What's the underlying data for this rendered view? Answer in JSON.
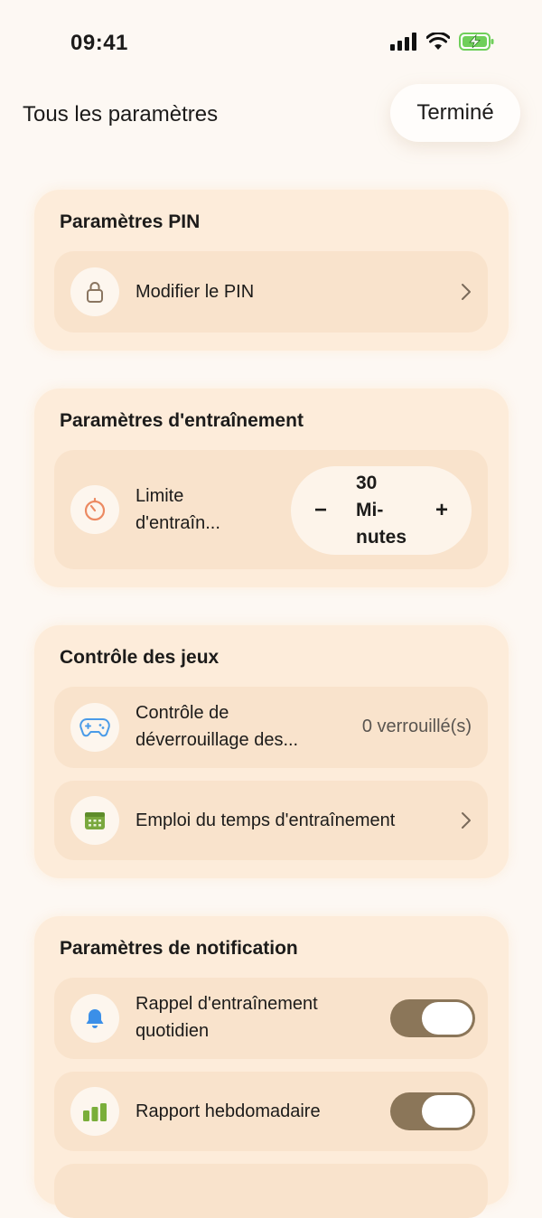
{
  "status_bar": {
    "time": "09:41"
  },
  "header": {
    "title": "Tous les paramètres",
    "done_label": "Terminé"
  },
  "sections": {
    "pin": {
      "title": "Paramètres PIN",
      "change_pin": "Modifier le PIN"
    },
    "training": {
      "title": "Paramètres d'entraînement",
      "limit_line1": "Limite",
      "limit_line2": "d'entraîn...",
      "stepper_minus": "−",
      "stepper_plus": "+",
      "stepper_value_line1": "30",
      "stepper_value_line2": "Mi-",
      "stepper_value_line3": "nutes"
    },
    "games": {
      "title": "Contrôle des jeux",
      "unlock_line1": "Contrôle de",
      "unlock_line2": "déverrouillage des...",
      "unlock_value": "0 verrouillé(s)",
      "schedule": "Emploi du temps d'entraînement"
    },
    "notifications": {
      "title": "Paramètres de notification",
      "daily_line1": "Rappel d'entraînement",
      "daily_line2": "quotidien",
      "daily_on": true,
      "weekly": "Rapport hebdomadaire",
      "weekly_on": true
    }
  },
  "colors": {
    "background": "#fdf8f3",
    "section": "#fdecda",
    "row": "#f9e3cc",
    "toggle_on": "#8b7659",
    "timer_icon": "#ec8a62",
    "gamepad_icon": "#4a9be8",
    "calendar_icon": "#7aa83e",
    "bell_icon": "#3b8fe8",
    "bars_icon": "#7aae3a"
  },
  "icons": [
    "signal-icon",
    "wifi-icon",
    "battery-charging-icon",
    "lock-icon",
    "chevron-right-icon",
    "timer-icon",
    "gamepad-icon",
    "calendar-icon",
    "bell-icon",
    "bar-chart-icon"
  ]
}
